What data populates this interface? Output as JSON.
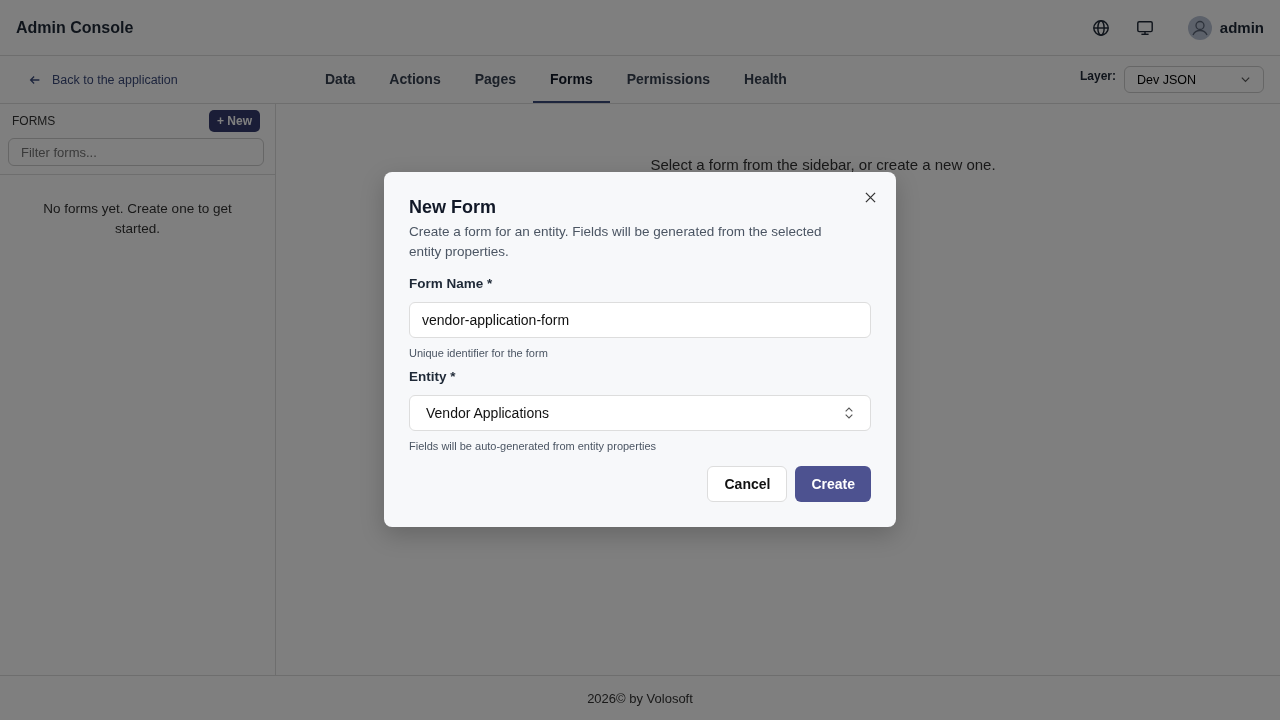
{
  "header": {
    "title": "Admin Console",
    "user": "admin"
  },
  "nav": {
    "back_link": "Back to the application",
    "tabs": [
      {
        "label": "Data",
        "selected": false
      },
      {
        "label": "Actions",
        "selected": false
      },
      {
        "label": "Pages",
        "selected": false
      },
      {
        "label": "Forms",
        "selected": true
      },
      {
        "label": "Permissions",
        "selected": false
      },
      {
        "label": "Health",
        "selected": false
      }
    ],
    "layer_label": "Layer:",
    "layer_value": "Dev JSON"
  },
  "sidebar": {
    "heading": "FORMS",
    "new_button": "+ New",
    "filter_placeholder": "Filter forms...",
    "empty_text": "No forms yet. Create one to get started."
  },
  "main": {
    "hint": "Select a form from the sidebar, or create a new one."
  },
  "dialog": {
    "title": "New Form",
    "description": "Create a form for an entity. Fields will be generated from the selected entity properties.",
    "fields": [
      {
        "kind": "text",
        "label": "Form Name *",
        "value": "vendor-application-form",
        "help": "Unique identifier for the form"
      },
      {
        "kind": "select",
        "label": "Entity *",
        "value": "Vendor Applications",
        "help": "Fields will be auto-generated from entity properties"
      }
    ],
    "buttons": [
      {
        "kind": "secondary",
        "label": "Cancel"
      },
      {
        "kind": "primary",
        "label": "Create"
      }
    ]
  },
  "footer": "2026© by Volosoft"
}
